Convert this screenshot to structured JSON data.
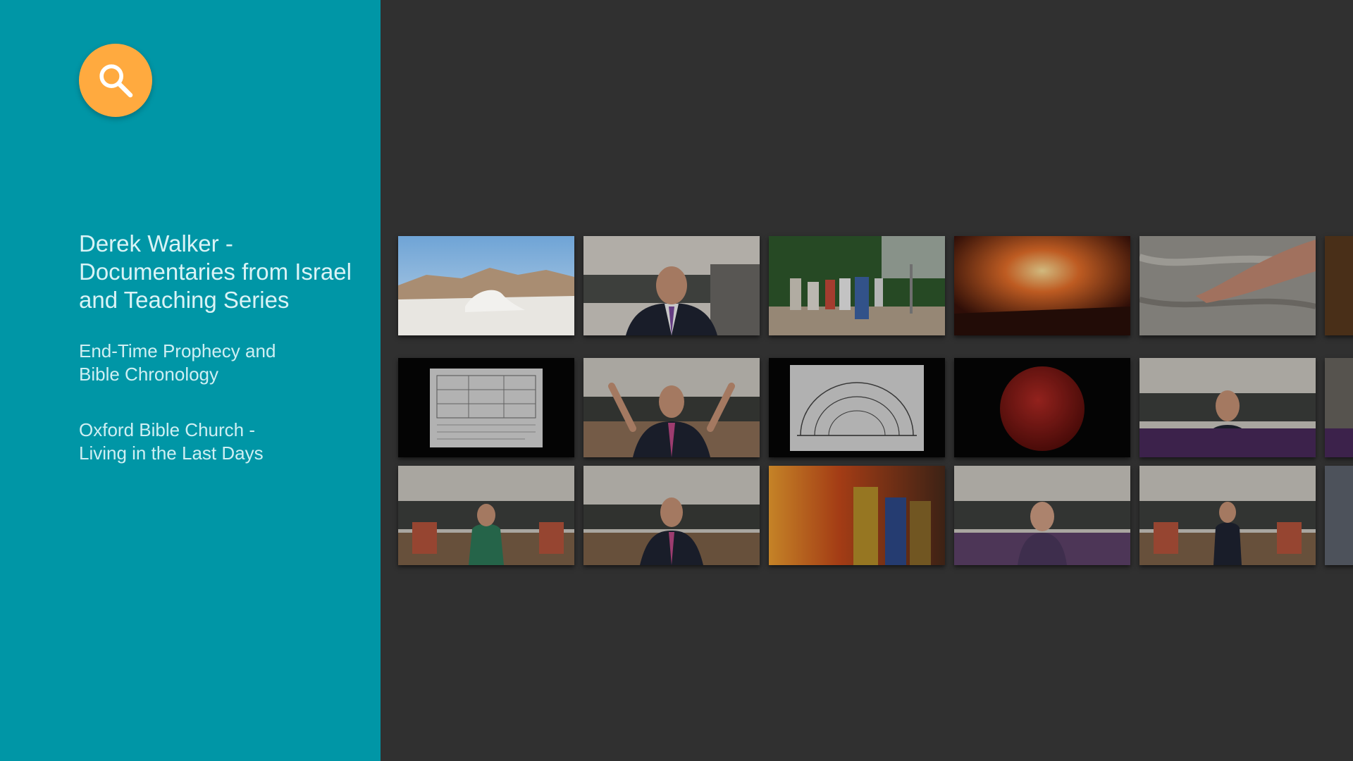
{
  "search": {
    "icon": "search-icon",
    "color": "#FFAA3F"
  },
  "sidebar": {
    "background": "#0096A6",
    "rows": [
      {
        "label": "Derek Walker -\nDocumentaries from Israel\nand Teaching Series",
        "selected": true
      },
      {
        "label": "End-Time Prophecy and\nBible Chronology",
        "selected": false
      },
      {
        "label": "Oxford Bible Church -\nLiving in the Last Days",
        "selected": false
      }
    ]
  },
  "content_rows": [
    {
      "cards": [
        {
          "thumbnail": "desert-landscape"
        },
        {
          "thumbnail": "speaker-in-suit"
        },
        {
          "thumbnail": "tour-group"
        },
        {
          "thumbnail": "fiery-painting"
        },
        {
          "thumbnail": "hand-on-rock"
        },
        {
          "thumbnail": "partial-card"
        }
      ]
    },
    {
      "cards": [
        {
          "thumbnail": "document-chart"
        },
        {
          "thumbnail": "preacher-arms-raised"
        },
        {
          "thumbnail": "arc-diagram"
        },
        {
          "thumbnail": "blood-moon"
        },
        {
          "thumbnail": "speaker-with-caption"
        },
        {
          "thumbnail": "partial-card"
        }
      ]
    },
    {
      "cards": [
        {
          "thumbnail": "woman-speaker-room"
        },
        {
          "thumbnail": "man-speaker-room"
        },
        {
          "thumbnail": "fire-painting-figures"
        },
        {
          "thumbnail": "woman-speaker-caption"
        },
        {
          "thumbnail": "man-speaker-wide"
        },
        {
          "thumbnail": "partial-card"
        }
      ]
    }
  ]
}
